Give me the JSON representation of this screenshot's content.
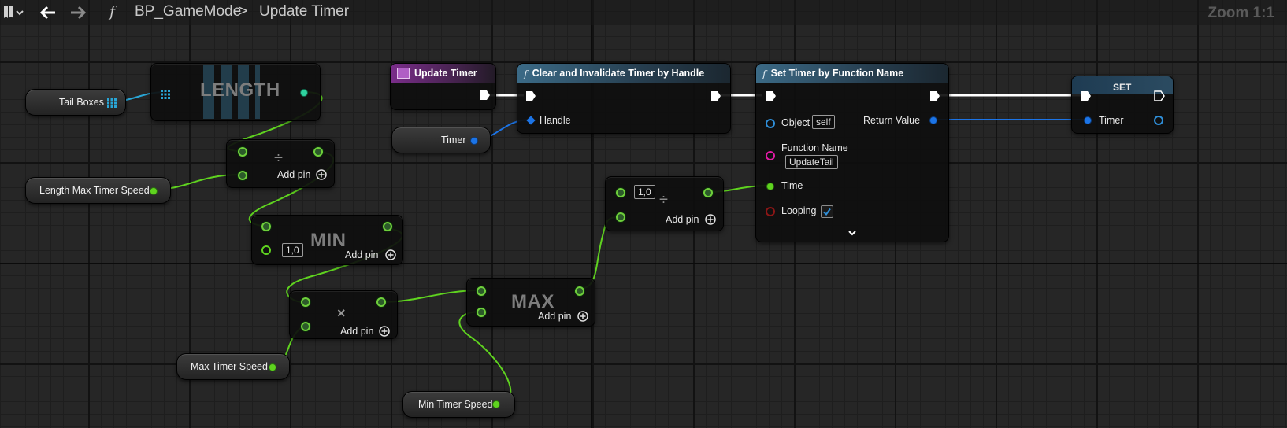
{
  "topbar": {
    "breadcrumb_blueprint": "BP_GameMode",
    "breadcrumb_separator": ">",
    "breadcrumb_function": "Update Timer",
    "zoom": "Zoom 1:1",
    "function_glyph": "f",
    "icons": [
      "bookmark-icon",
      "chevron-down-icon",
      "back-arrow-icon",
      "forward-arrow-icon"
    ]
  },
  "variables": {
    "tail_boxes": "Tail Boxes",
    "length_max_timer_speed": "Length Max Timer Speed",
    "max_timer_speed": "Max Timer Speed",
    "min_timer_speed": "Min Timer Speed",
    "timer": "Timer"
  },
  "nodes": {
    "length": {
      "title": "LENGTH"
    },
    "divide": {
      "symbol": "÷",
      "add_pin": "Add pin"
    },
    "min": {
      "title": "MIN",
      "default_value": "1,0",
      "add_pin": "Add pin"
    },
    "multiply": {
      "symbol": "×",
      "add_pin": "Add pin"
    },
    "max": {
      "title": "MAX",
      "add_pin": "Add pin"
    },
    "divide2": {
      "symbol": "÷",
      "default_value": "1,0",
      "add_pin": "Add pin"
    },
    "update_timer": {
      "title": "Update Timer"
    },
    "clear_timer": {
      "title": "Clear and Invalidate Timer by Handle",
      "handle": "Handle"
    },
    "set_timer": {
      "title": "Set Timer by Function Name",
      "object": "Object",
      "object_value": "self",
      "function_name": "Function Name",
      "function_name_value": "UpdateTail",
      "time": "Time",
      "looping": "Looping",
      "looping_checked": true,
      "return_value": "Return Value"
    },
    "set": {
      "title": "SET",
      "timer": "Timer"
    }
  },
  "colors": {
    "float_wire": "#5fd31f",
    "struct_wire": "#1c74e6",
    "array_wire": "#29a6d6",
    "exec_wire": "#ffffff",
    "function_header": "#3b6a86",
    "event_header": "#7a2d8a"
  }
}
